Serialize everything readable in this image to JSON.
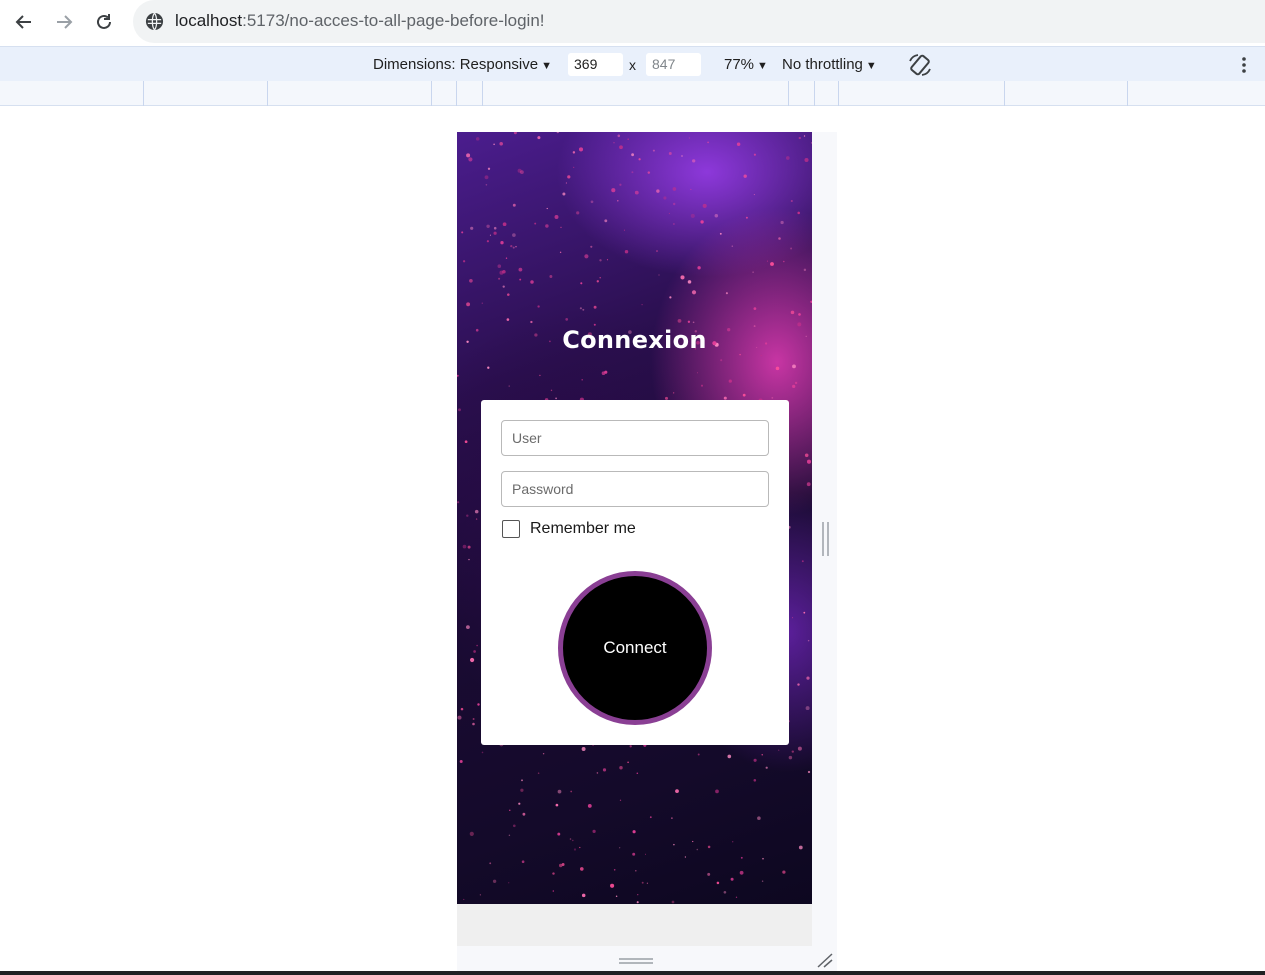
{
  "browser": {
    "url_host": "localhost",
    "url_path": ":5173/no-acces-to-all-page-before-login!",
    "icons": [
      "back-arrow-icon",
      "forward-arrow-icon",
      "reload-icon",
      "site-info-icon"
    ]
  },
  "devtools": {
    "dimensions_label": "Dimensions: Responsive",
    "width_value": "369",
    "height_value": "847",
    "separator": "x",
    "zoom": "77%",
    "throttling": "No throttling",
    "icons": [
      "dropdown-triangle-icon",
      "rotate-icon",
      "more-options-icon"
    ]
  },
  "login": {
    "title": "Connexion",
    "user_placeholder": "User",
    "password_placeholder": "Password",
    "remember_label": "Remember me",
    "remember_checked": false,
    "connect_label": "Connect"
  },
  "colors": {
    "card_bg": "#ffffff",
    "button_bg": "#000000",
    "button_border": "#8a3f94",
    "bg_purple": "#4b1d8e",
    "bg_pink": "#e43cb4",
    "devbar_bg": "#e9f0fb"
  }
}
